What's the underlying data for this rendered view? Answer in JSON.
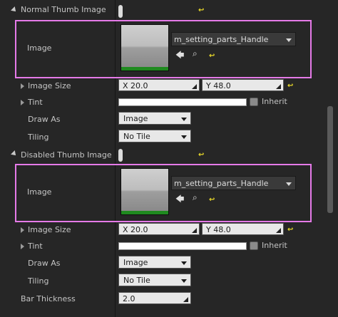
{
  "normal": {
    "section_label": "Normal Thumb Image",
    "image_label": "Image",
    "asset_name": "m_setting_parts_Handle",
    "image_size_label": "Image Size",
    "size_x": "X  20.0",
    "size_y": "Y  48.0",
    "tint_label": "Tint",
    "inherit_label": "Inherit",
    "draw_as_label": "Draw As",
    "draw_as_value": "Image",
    "tiling_label": "Tiling",
    "tiling_value": "No Tile"
  },
  "disabled": {
    "section_label": "Disabled Thumb Image",
    "image_label": "Image",
    "asset_name": "m_setting_parts_Handle",
    "image_size_label": "Image Size",
    "size_x": "X  20.0",
    "size_y": "Y  48.0",
    "tint_label": "Tint",
    "inherit_label": "Inherit",
    "draw_as_label": "Draw As",
    "draw_as_value": "Image",
    "tiling_label": "Tiling",
    "tiling_value": "No Tile"
  },
  "bar_thickness": {
    "label": "Bar Thickness",
    "value": "2.0"
  },
  "icons": {
    "reset": "↩",
    "browse_back": "←",
    "search": "⌕",
    "expand": "▸",
    "collapse": "◢"
  }
}
